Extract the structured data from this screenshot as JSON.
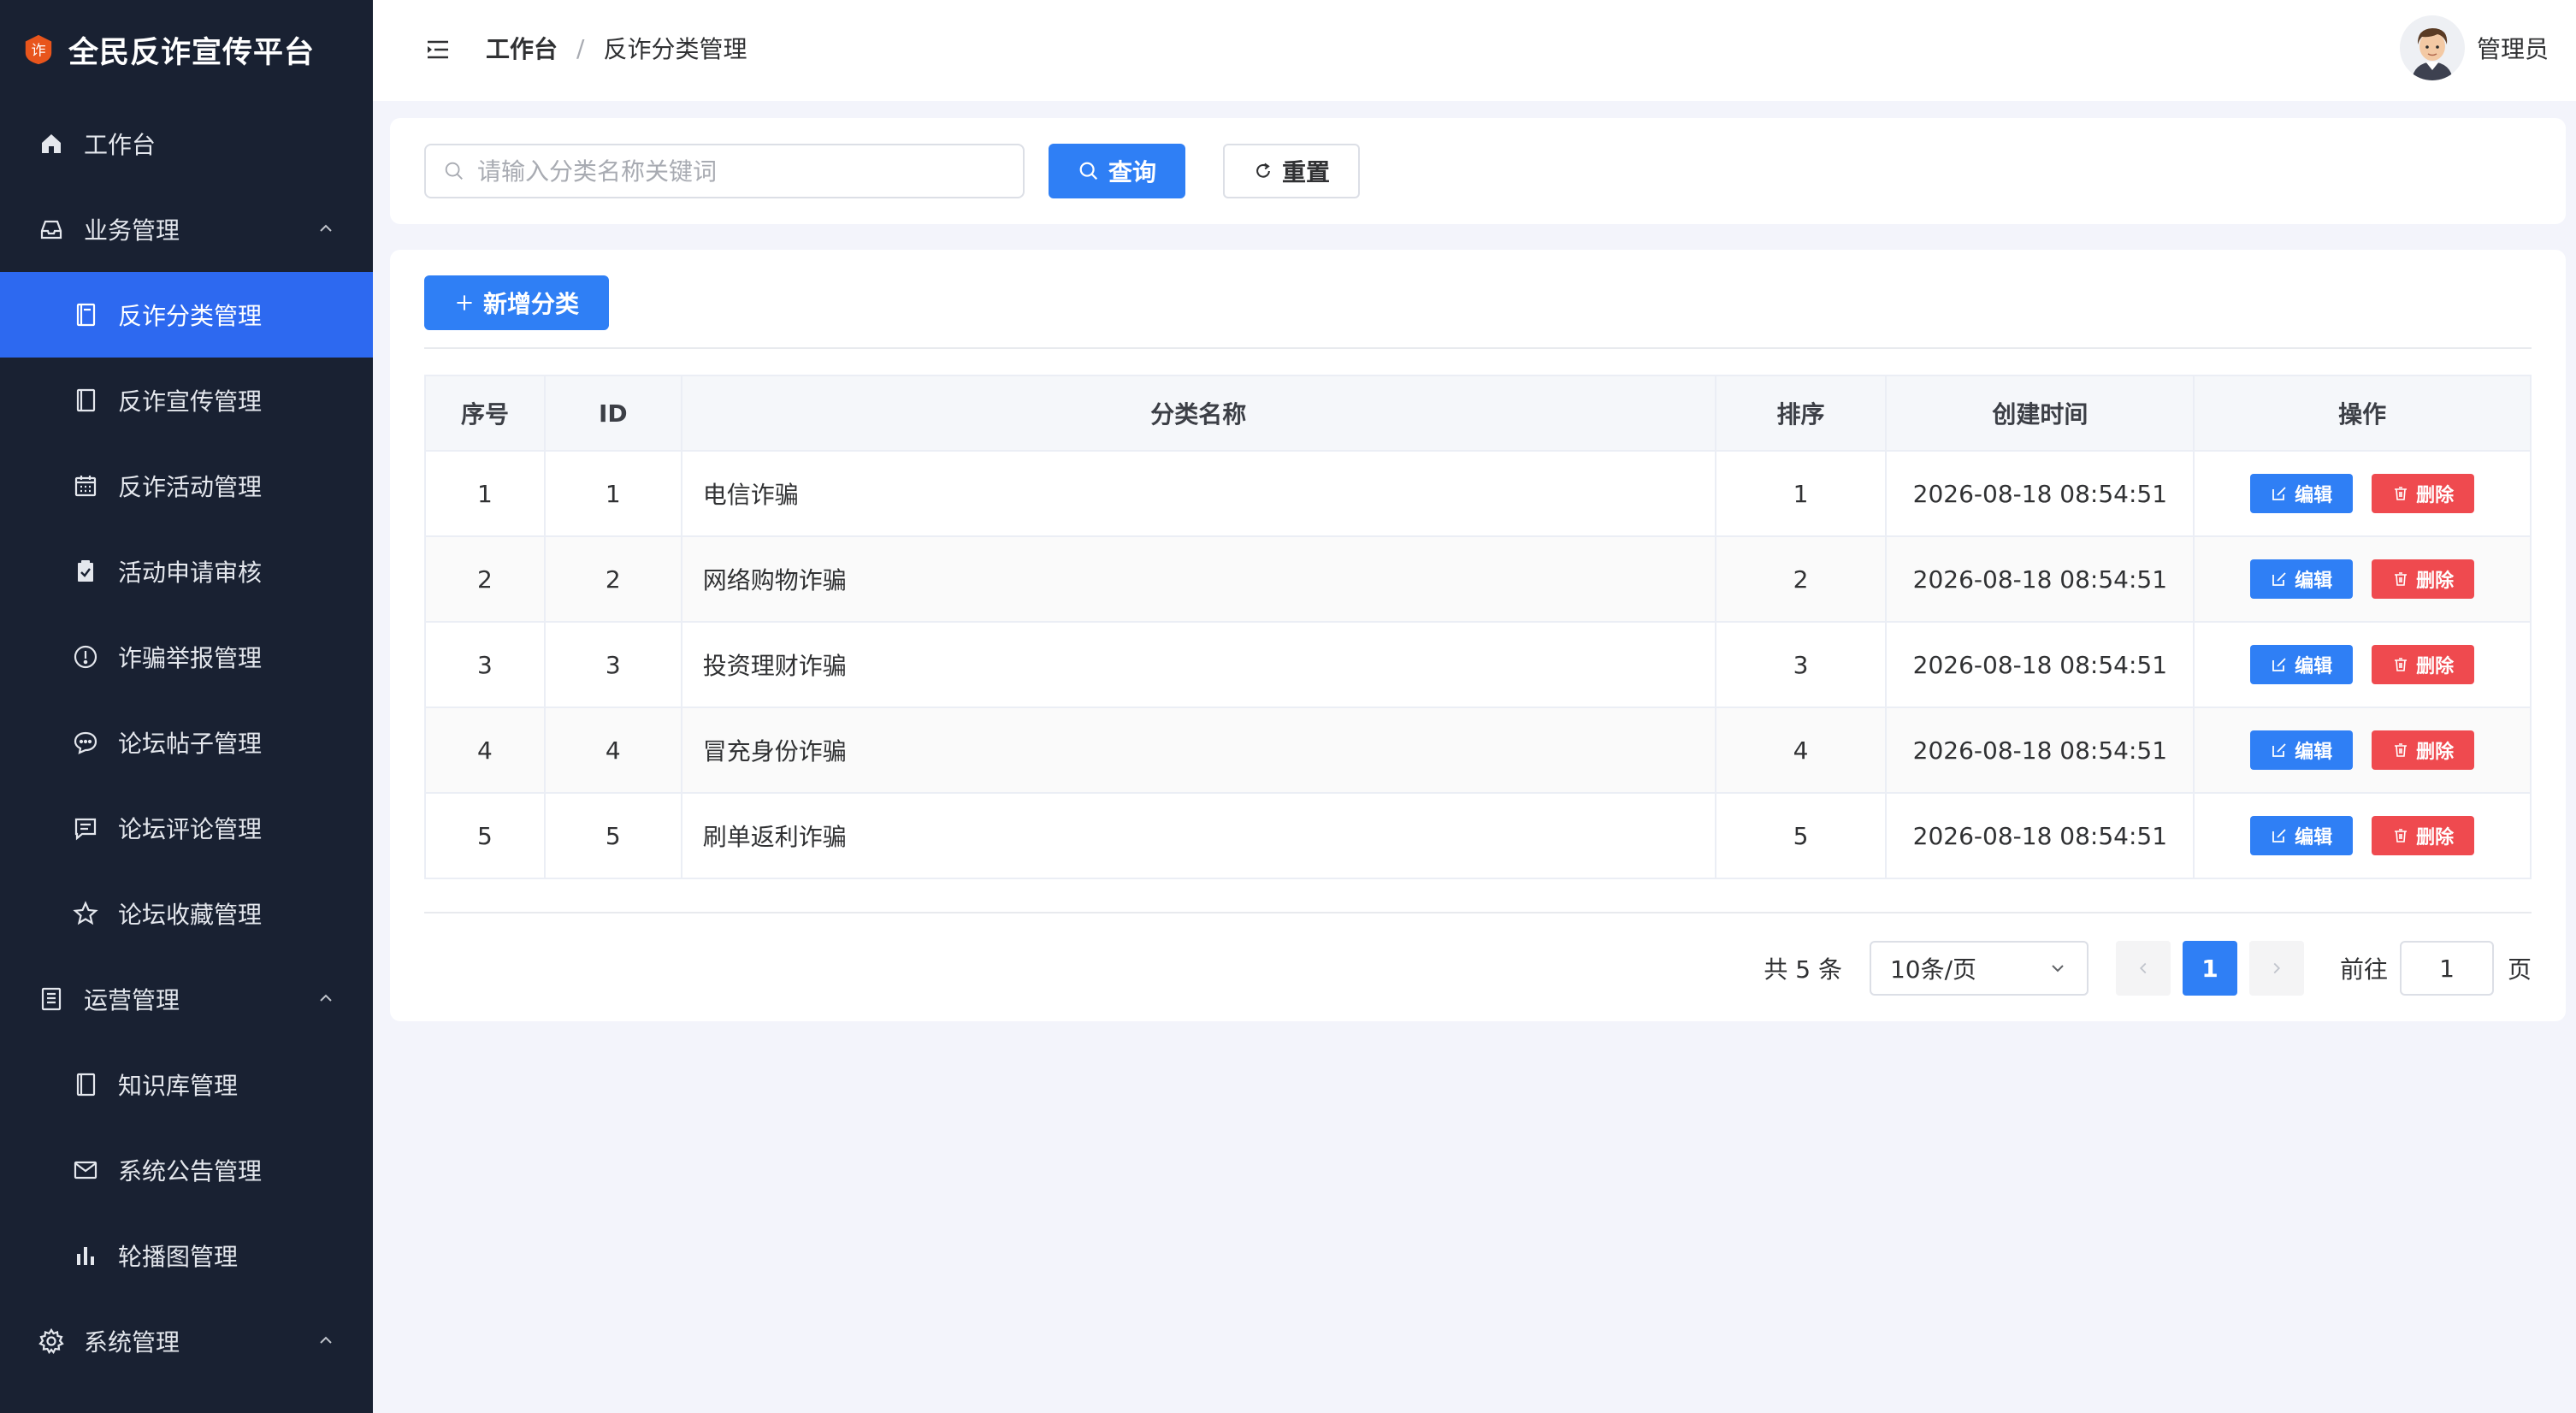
{
  "brand": {
    "title": "全民反诈宣传平台",
    "logo_char": "诈",
    "accent": "#e8551c"
  },
  "sidebar": {
    "items": [
      {
        "label": "工作台",
        "icon": "home-icon",
        "level": "top"
      },
      {
        "label": "业务管理",
        "icon": "inbox-icon",
        "level": "top",
        "expanded": true
      },
      {
        "label": "反诈分类管理",
        "icon": "notebook-icon",
        "level": "sub",
        "active": true
      },
      {
        "label": "反诈宣传管理",
        "icon": "notebook-icon",
        "level": "sub"
      },
      {
        "label": "反诈活动管理",
        "icon": "calendar-icon",
        "level": "sub"
      },
      {
        "label": "活动申请审核",
        "icon": "checked-icon",
        "level": "sub"
      },
      {
        "label": "诈骗举报管理",
        "icon": "warning-icon",
        "level": "sub"
      },
      {
        "label": "论坛帖子管理",
        "icon": "chat-dot-icon",
        "level": "sub"
      },
      {
        "label": "论坛评论管理",
        "icon": "chat-line-icon",
        "level": "sub"
      },
      {
        "label": "论坛收藏管理",
        "icon": "star-icon",
        "level": "sub"
      },
      {
        "label": "运营管理",
        "icon": "tickets-icon",
        "level": "top",
        "expanded": true
      },
      {
        "label": "知识库管理",
        "icon": "notebook-icon",
        "level": "sub"
      },
      {
        "label": "系统公告管理",
        "icon": "message-icon",
        "level": "sub"
      },
      {
        "label": "轮播图管理",
        "icon": "histogram-icon",
        "level": "sub"
      },
      {
        "label": "系统管理",
        "icon": "setting-icon",
        "level": "top",
        "expanded": true
      }
    ]
  },
  "header": {
    "breadcrumb": [
      "工作台",
      "反诈分类管理"
    ],
    "separator": "/",
    "user_name": "管理员"
  },
  "search": {
    "placeholder": "请输入分类名称关键词",
    "value": "",
    "search_label": "查询",
    "reset_label": "重置"
  },
  "toolbar": {
    "add_label": "新增分类"
  },
  "table": {
    "columns": [
      "序号",
      "ID",
      "分类名称",
      "排序",
      "创建时间",
      "操作"
    ],
    "rows": [
      {
        "index": "1",
        "id": "1",
        "name": "电信诈骗",
        "sort": "1",
        "created": "2026-08-18 08:54:51"
      },
      {
        "index": "2",
        "id": "2",
        "name": "网络购物诈骗",
        "sort": "2",
        "created": "2026-08-18 08:54:51"
      },
      {
        "index": "3",
        "id": "3",
        "name": "投资理财诈骗",
        "sort": "3",
        "created": "2026-08-18 08:54:51"
      },
      {
        "index": "4",
        "id": "4",
        "name": "冒充身份诈骗",
        "sort": "4",
        "created": "2026-08-18 08:54:51"
      },
      {
        "index": "5",
        "id": "5",
        "name": "刷单返利诈骗",
        "sort": "5",
        "created": "2026-08-18 08:54:51"
      }
    ],
    "edit_label": "编辑",
    "delete_label": "删除"
  },
  "pagination": {
    "total_text": "共 5 条",
    "page_size": "10条/页",
    "current_page": "1",
    "goto_label": "前往",
    "goto_value": "1",
    "page_suffix": "页"
  },
  "colors": {
    "primary": "#2f7ff5",
    "danger": "#ef4a4f",
    "sidebar_bg": "#192132",
    "active_menu": "#2d69f0"
  }
}
